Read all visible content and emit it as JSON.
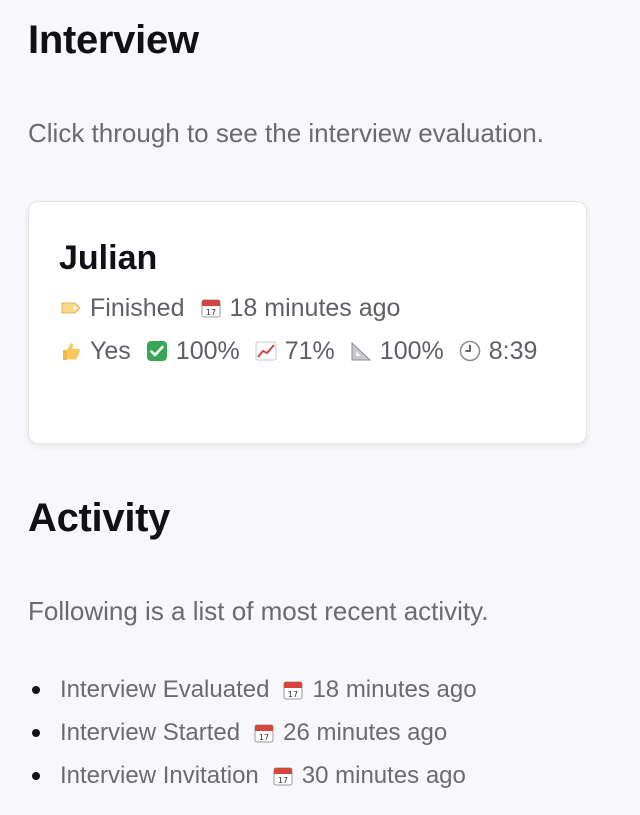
{
  "interview_section": {
    "title": "Interview",
    "description": "Click through to see the interview evaluation."
  },
  "card": {
    "name": "Julian",
    "status_icon": "label-tag-icon",
    "status": "Finished",
    "date_icon": "calendar-icon",
    "time_ago": "18 minutes ago",
    "metrics": [
      {
        "icon": "thumbs-up-icon",
        "value": "Yes"
      },
      {
        "icon": "check-mark-button-icon",
        "value": "100%"
      },
      {
        "icon": "chart-increasing-icon",
        "value": "71%"
      },
      {
        "icon": "triangular-ruler-icon",
        "value": "100%"
      },
      {
        "icon": "clock-icon",
        "value": "8:39"
      }
    ]
  },
  "activity_section": {
    "title": "Activity",
    "description": "Following is a list of most recent activity.",
    "items": [
      {
        "label": "Interview Evaluated",
        "icon": "calendar-icon",
        "time_ago": "18 minutes ago"
      },
      {
        "label": "Interview Started",
        "icon": "calendar-icon",
        "time_ago": "26 minutes ago"
      },
      {
        "label": "Interview Invitation",
        "icon": "calendar-icon",
        "time_ago": "30 minutes ago"
      }
    ]
  },
  "colors": {
    "background": "#f8f8fa",
    "card_background": "#ffffff",
    "heading": "#0f1117",
    "muted_text": "#6a6a72",
    "check_green": "#3aa757",
    "calendar_red": "#d6453d"
  }
}
